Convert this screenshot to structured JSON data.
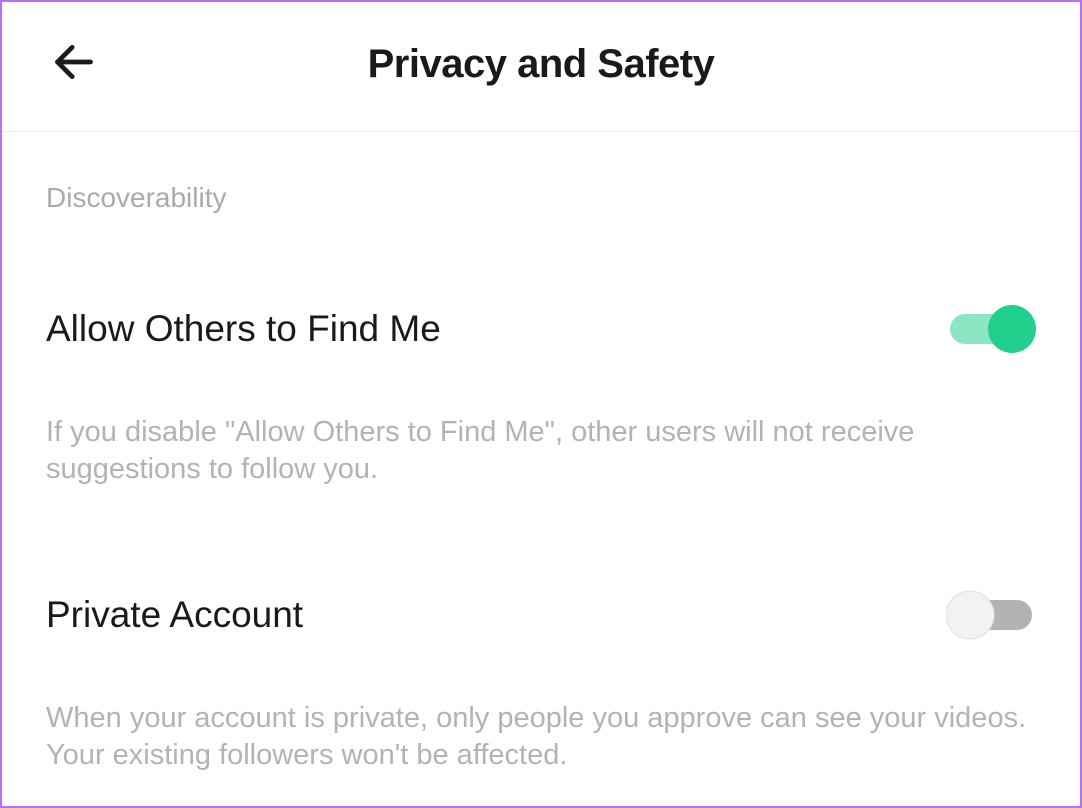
{
  "header": {
    "title": "Privacy and Safety"
  },
  "discoverability": {
    "section_label": "Discoverability",
    "find_me": {
      "label": "Allow Others to Find Me",
      "description": "If you disable \"Allow Others to Find Me\", other users will not receive suggestions to follow you.",
      "enabled": true
    },
    "private_account": {
      "label": "Private Account",
      "description": "When your account is private, only people you approve can see your videos. Your existing followers won't be affected.",
      "enabled": false
    }
  },
  "colors": {
    "accent": "#21d08c",
    "toggle_off_track": "#b3b3b3",
    "toggle_off_knob": "#f2f2f2"
  }
}
